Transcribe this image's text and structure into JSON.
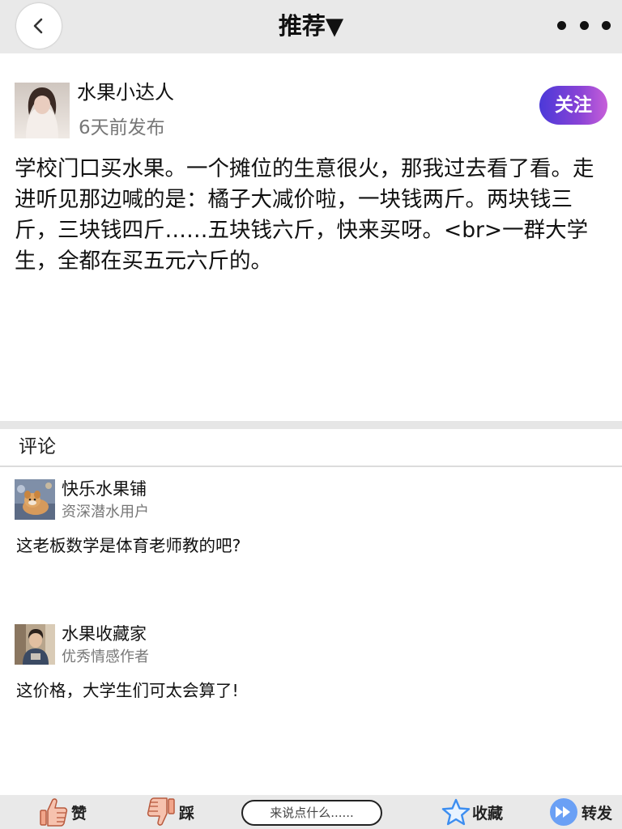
{
  "header": {
    "title": "推荐▼"
  },
  "post": {
    "author": "水果小达人",
    "time": "6天前发布",
    "follow_label": "关注",
    "content": "学校门口买水果。一个摊位的生意很火，那我过去看了看。走进听见那边喊的是：橘子大减价啦，一块钱两斤。两块钱三斤，三块钱四斤……五块钱六斤，快来买呀。<br>一群大学生，全都在买五元六斤的。"
  },
  "comments": {
    "title": "评论",
    "items": [
      {
        "name": "快乐水果铺",
        "badge": "资深潜水用户",
        "text": "这老板数学是体育老师教的吧?"
      },
      {
        "name": "水果收藏家",
        "badge": "优秀情感作者",
        "text": "这价格，大学生们可太会算了!"
      }
    ]
  },
  "bottom_bar": {
    "like_label": "赞",
    "dislike_label": "踩",
    "comment_placeholder": "来说点什么......",
    "favorite_label": "收藏",
    "share_label": "转发"
  },
  "colors": {
    "follow_gradient_start": "#4b39d8",
    "follow_gradient_end": "#c75fd9",
    "like_icon": "#f1a58a",
    "favorite_icon": "#3d8ef0",
    "share_icon": "#6aa0f5"
  },
  "icons": {
    "back": "chevron-left-icon",
    "more": "more-dots-icon",
    "like": "thumbs-up-icon",
    "dislike": "thumbs-down-icon",
    "favorite": "star-icon",
    "share": "fast-forward-icon"
  }
}
